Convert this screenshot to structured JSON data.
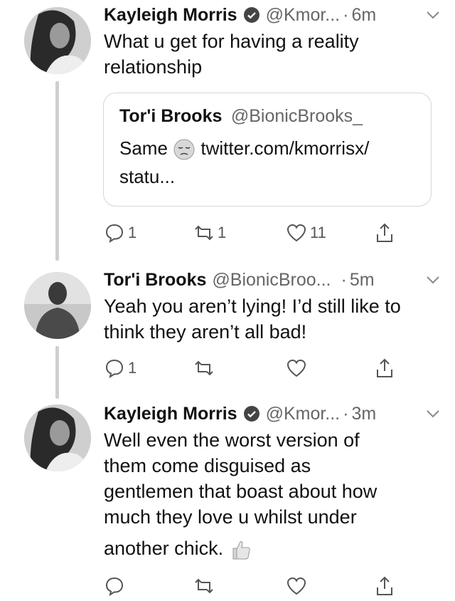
{
  "tweets": [
    {
      "name": "Kayleigh Morris",
      "handle": "@Kmor...",
      "time": "6m",
      "text_lines": [
        "What u get for having a reality",
        "relationship"
      ],
      "quote": {
        "name": "Tor'i Brooks",
        "handle": "@BionicBrooks_",
        "text_line1_prefix": "Same",
        "text_line1_link": "twitter.com/kmorrisx/",
        "text_line2": "statu..."
      },
      "actions": {
        "replies": "1",
        "retweets": "1",
        "likes": "11"
      }
    },
    {
      "name": "Tor'i Brooks",
      "handle": "@BionicBroo...",
      "time": "5m",
      "text_lines": [
        "Yeah you aren’t lying! I’d still like to",
        "think they aren’t all bad!"
      ],
      "actions": {
        "replies": "1",
        "retweets": "",
        "likes": ""
      }
    },
    {
      "name": "Kayleigh Morris",
      "handle": "@Kmor...",
      "time": "3m",
      "text_lines": [
        "Well even the worst version of",
        "them come disguised as",
        "gentlemen that boast about how",
        "much they love u whilst under",
        "another chick."
      ],
      "actions": {
        "replies": "",
        "retweets": "",
        "likes": ""
      }
    }
  ],
  "separator": "·",
  "icons": [
    "verified-badge-icon",
    "chevron-down-icon",
    "reply-icon",
    "retweet-icon",
    "like-icon",
    "share-icon",
    "pensive-face-emoji",
    "thumbs-up-emoji"
  ]
}
